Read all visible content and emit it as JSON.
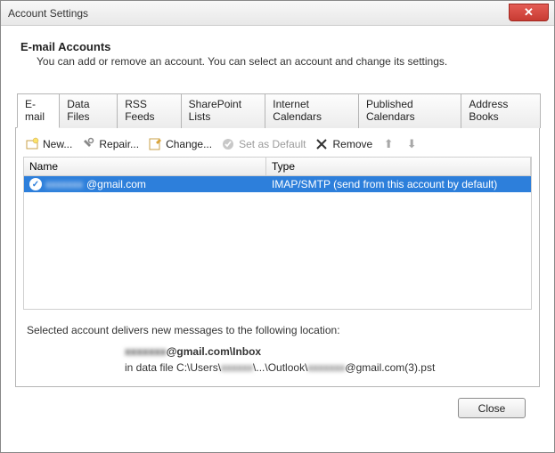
{
  "window": {
    "title": "Account Settings",
    "close_glyph": "✕"
  },
  "header": {
    "title": "E-mail Accounts",
    "subtitle": "You can add or remove an account. You can select an account and change its settings."
  },
  "tabs": [
    {
      "label": "E-mail",
      "active": true
    },
    {
      "label": "Data Files",
      "active": false
    },
    {
      "label": "RSS Feeds",
      "active": false
    },
    {
      "label": "SharePoint Lists",
      "active": false
    },
    {
      "label": "Internet Calendars",
      "active": false
    },
    {
      "label": "Published Calendars",
      "active": false
    },
    {
      "label": "Address Books",
      "active": false
    }
  ],
  "toolbar": {
    "new": "New...",
    "repair": "Repair...",
    "change": "Change...",
    "set_default": "Set as Default",
    "remove": "Remove"
  },
  "columns": {
    "name": "Name",
    "type": "Type"
  },
  "accounts": [
    {
      "name_prefix": "xxxxxxx",
      "name_suffix": "@gmail.com",
      "type": "IMAP/SMTP (send from this account by default)",
      "default": true,
      "selected": true
    }
  ],
  "delivery": {
    "intro": "Selected account delivers new messages to the following location:",
    "mailbox_prefix": "xxxxxxx",
    "mailbox_suffix": "@gmail.com\\Inbox",
    "path_p1": "in data file C:\\Users\\",
    "path_blur1": "xxxxxx",
    "path_p2": "\\...\\Outlook\\",
    "path_blur2": "xxxxxxx",
    "path_p3": "@gmail.com(3).pst"
  },
  "footer": {
    "close": "Close"
  }
}
